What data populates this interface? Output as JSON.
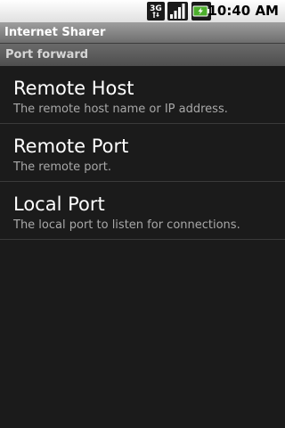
{
  "status_bar": {
    "network_label": "3G",
    "time": "10:40 AM",
    "icons": [
      "3g-data-icon",
      "signal-strength-icon",
      "battery-icon"
    ]
  },
  "app": {
    "title": "Internet Sharer"
  },
  "category": {
    "label": "Port forward"
  },
  "preferences": [
    {
      "title": "Remote Host",
      "summary": "The remote host name or IP address."
    },
    {
      "title": "Remote Port",
      "summary": "The remote port."
    },
    {
      "title": "Local Port",
      "summary": "The local port to listen for connections."
    }
  ],
  "colors": {
    "background": "#1b1b1b",
    "battery_green": "#4caf2c"
  }
}
